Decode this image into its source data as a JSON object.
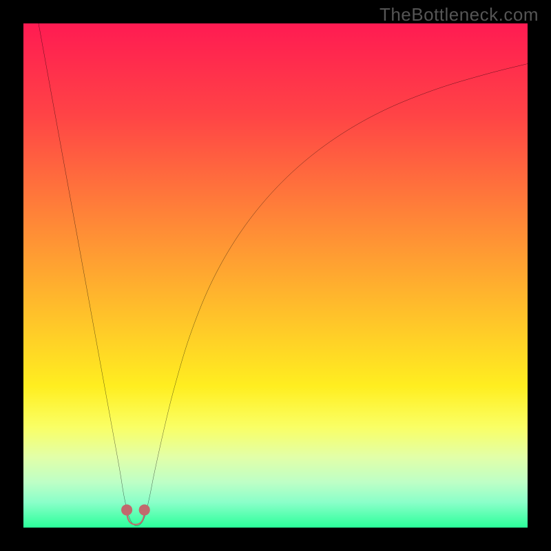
{
  "watermark": {
    "text": "TheBottleneck.com"
  },
  "chart_data": {
    "type": "line",
    "title": "",
    "xlabel": "",
    "ylabel": "",
    "xlim": [
      0,
      100
    ],
    "ylim": [
      0,
      100
    ],
    "series": [
      {
        "name": "bottleneck-curve",
        "x": [
          3,
          5,
          7,
          9,
          11,
          13,
          15,
          17,
          19,
          20,
          21,
          22,
          23,
          24,
          25,
          26,
          28,
          30,
          33,
          37,
          42,
          48,
          55,
          63,
          72,
          82,
          92,
          100
        ],
        "y": [
          100,
          89,
          78,
          67,
          56,
          45,
          34,
          23,
          12,
          6,
          2,
          0.5,
          0.5,
          2,
          6,
          11,
          20,
          28,
          38,
          48,
          57,
          65,
          72,
          78,
          83,
          87,
          90,
          92
        ]
      }
    ],
    "marker_region": {
      "x_range": [
        20.5,
        24
      ],
      "y_range": [
        0,
        3.5
      ],
      "color": "#c1696d"
    },
    "background_gradient": {
      "stops": [
        {
          "pct": 0,
          "color": "#ff1b52"
        },
        {
          "pct": 18,
          "color": "#ff4346"
        },
        {
          "pct": 38,
          "color": "#ff8338"
        },
        {
          "pct": 58,
          "color": "#ffc22a"
        },
        {
          "pct": 72,
          "color": "#ffee20"
        },
        {
          "pct": 80,
          "color": "#faff64"
        },
        {
          "pct": 86,
          "color": "#e2ffa8"
        },
        {
          "pct": 91,
          "color": "#beffc6"
        },
        {
          "pct": 95,
          "color": "#8affc9"
        },
        {
          "pct": 100,
          "color": "#2bff9a"
        }
      ]
    }
  }
}
